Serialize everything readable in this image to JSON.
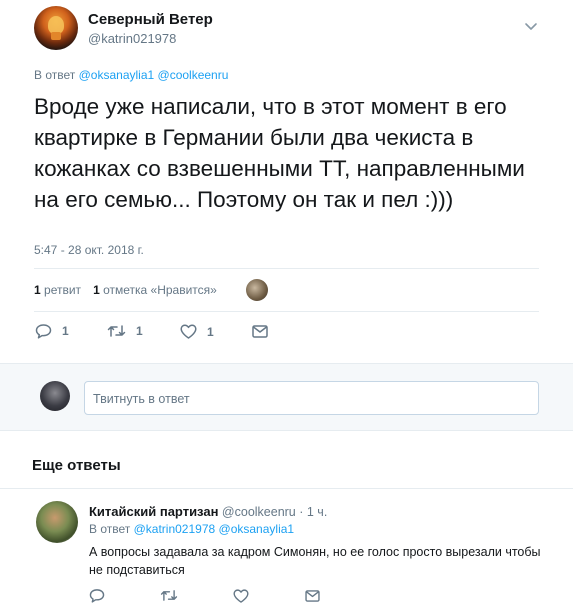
{
  "tweet": {
    "user_name": "Северный Ветер",
    "user_handle": "@katrin021978",
    "reply_prefix": "В ответ",
    "reply_mentions": [
      "@oksanaylia1",
      "@coolkeenru"
    ],
    "text": "Вроде уже написали, что в этот момент в его квартирке в Германии были два чекиста в кожанках со взвешенными ТТ, направленными на его семью... Поэтому он так и пел :)))",
    "timestamp": "5:47 - 28 окт. 2018 г.",
    "stats": {
      "retweets_count": "1",
      "retweets_label": "ретвит",
      "likes_count": "1",
      "likes_label": "отметка «Нравится»"
    },
    "actions": {
      "reply_count": "1",
      "retweet_count": "1",
      "like_count": "1"
    }
  },
  "compose": {
    "placeholder": "Твитнуть в ответ"
  },
  "more_replies": {
    "title": "Еще ответы"
  },
  "reply": {
    "user_name": "Китайский партизан",
    "user_handle": "@coolkeenru",
    "time": "· 1 ч.",
    "reply_prefix": "В ответ",
    "reply_mentions": [
      "@katrin021978",
      "@oksanaylia1"
    ],
    "text": "А вопросы задавала за кадром Симонян, но ее голос просто вырезали чтобы не подставиться"
  },
  "colors": {
    "accent": "#1da1f2",
    "secondary_text": "#657786",
    "primary_text": "#14171a",
    "divider": "#e6ecf0"
  }
}
